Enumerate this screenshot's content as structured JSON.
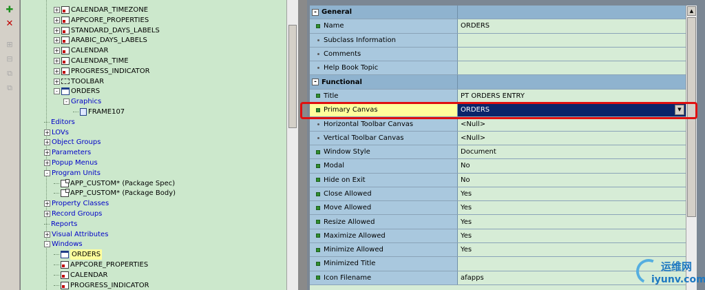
{
  "toolbar": {
    "buttons": [
      {
        "icon": "plus-icon",
        "glyph": "✚"
      },
      {
        "icon": "close-icon",
        "glyph": "✕"
      },
      {
        "icon": "expand-icon",
        "glyph": "⊞"
      },
      {
        "icon": "collapse-icon",
        "glyph": "⊟"
      },
      {
        "icon": "expand-all-icon",
        "glyph": "⧉"
      },
      {
        "icon": "collapse-all-icon",
        "glyph": "⧉"
      }
    ]
  },
  "navigator": {
    "items": [
      {
        "label": "CALENDAR_TIMEZONE",
        "indent": 2,
        "expander": "+",
        "icon": "doc",
        "color": "black"
      },
      {
        "label": "APPCORE_PROPERTIES",
        "indent": 2,
        "expander": "+",
        "icon": "doc",
        "color": "black"
      },
      {
        "label": "STANDARD_DAYS_LABELS",
        "indent": 2,
        "expander": "+",
        "icon": "doc",
        "color": "black"
      },
      {
        "label": "ARABIC_DAYS_LABELS",
        "indent": 2,
        "expander": "+",
        "icon": "doc",
        "color": "black"
      },
      {
        "label": "CALENDAR",
        "indent": 2,
        "expander": "+",
        "icon": "doc",
        "color": "black"
      },
      {
        "label": "CALENDAR_TIME",
        "indent": 2,
        "expander": "+",
        "icon": "doc",
        "color": "black"
      },
      {
        "label": "PROGRESS_INDICATOR",
        "indent": 2,
        "expander": "+",
        "icon": "doc",
        "color": "black"
      },
      {
        "label": "TOOLBAR",
        "indent": 2,
        "expander": "+",
        "icon": "tbar",
        "color": "black"
      },
      {
        "label": "ORDERS",
        "indent": 2,
        "expander": "-",
        "icon": "win",
        "color": "black"
      },
      {
        "label": "Graphics",
        "indent": 3,
        "expander": "-",
        "icon": "none",
        "color": "blue"
      },
      {
        "label": "FRAME107",
        "indent": 4,
        "expander": "",
        "icon": "frame",
        "color": "black"
      },
      {
        "label": "Editors",
        "indent": 1,
        "expander": "",
        "icon": "none",
        "color": "blue"
      },
      {
        "label": "LOVs",
        "indent": 1,
        "expander": "+",
        "icon": "none",
        "color": "blue"
      },
      {
        "label": "Object Groups",
        "indent": 1,
        "expander": "+",
        "icon": "none",
        "color": "blue"
      },
      {
        "label": "Parameters",
        "indent": 1,
        "expander": "+",
        "icon": "none",
        "color": "blue"
      },
      {
        "label": "Popup Menus",
        "indent": 1,
        "expander": "+",
        "icon": "none",
        "color": "blue"
      },
      {
        "label": "Program Units",
        "indent": 1,
        "expander": "-",
        "icon": "none",
        "color": "blue"
      },
      {
        "label": "APP_CUSTOM* (Package Spec)",
        "indent": 2,
        "expander": "",
        "icon": "pkg",
        "color": "black"
      },
      {
        "label": "APP_CUSTOM* (Package Body)",
        "indent": 2,
        "expander": "",
        "icon": "pkg",
        "color": "black"
      },
      {
        "label": "Property Classes",
        "indent": 1,
        "expander": "+",
        "icon": "none",
        "color": "blue"
      },
      {
        "label": "Record Groups",
        "indent": 1,
        "expander": "+",
        "icon": "none",
        "color": "blue"
      },
      {
        "label": "Reports",
        "indent": 1,
        "expander": "",
        "icon": "none",
        "color": "blue"
      },
      {
        "label": "Visual Attributes",
        "indent": 1,
        "expander": "+",
        "icon": "none",
        "color": "blue"
      },
      {
        "label": "Windows",
        "indent": 1,
        "expander": "-",
        "icon": "none",
        "color": "blue"
      },
      {
        "label": "ORDERS",
        "indent": 2,
        "expander": "",
        "icon": "win",
        "color": "black",
        "selected": true
      },
      {
        "label": "APPCORE_PROPERTIES",
        "indent": 2,
        "expander": "",
        "icon": "doc",
        "color": "black"
      },
      {
        "label": "CALENDAR",
        "indent": 2,
        "expander": "",
        "icon": "doc",
        "color": "black"
      },
      {
        "label": "PROGRESS_INDICATOR",
        "indent": 2,
        "expander": "",
        "icon": "doc",
        "color": "black"
      }
    ]
  },
  "properties": {
    "rows": [
      {
        "type": "section",
        "name": "General",
        "toggle": "-"
      },
      {
        "type": "prop",
        "name": "Name",
        "value": "ORDERS",
        "marker": "set"
      },
      {
        "type": "prop",
        "name": "Subclass Information",
        "value": "",
        "marker": "def"
      },
      {
        "type": "prop",
        "name": "Comments",
        "value": "",
        "marker": "def"
      },
      {
        "type": "prop",
        "name": "Help Book Topic",
        "value": "",
        "marker": "def"
      },
      {
        "type": "section",
        "name": "Functional",
        "toggle": "-"
      },
      {
        "type": "prop",
        "name": "Title",
        "value": "PT ORDERS ENTRY",
        "marker": "set"
      },
      {
        "type": "prop",
        "name": "Primary Canvas",
        "value": "ORDERS",
        "marker": "set",
        "highlight": true,
        "dropdown": true
      },
      {
        "type": "prop",
        "name": "Horizontal Toolbar Canvas",
        "value": "<Null>",
        "marker": "def"
      },
      {
        "type": "prop",
        "name": "Vertical Toolbar Canvas",
        "value": "<Null>",
        "marker": "def"
      },
      {
        "type": "prop",
        "name": "Window Style",
        "value": "Document",
        "marker": "set"
      },
      {
        "type": "prop",
        "name": "Modal",
        "value": "No",
        "marker": "set"
      },
      {
        "type": "prop",
        "name": "Hide on Exit",
        "value": "No",
        "marker": "set"
      },
      {
        "type": "prop",
        "name": "Close Allowed",
        "value": "Yes",
        "marker": "set"
      },
      {
        "type": "prop",
        "name": "Move Allowed",
        "value": "Yes",
        "marker": "set"
      },
      {
        "type": "prop",
        "name": "Resize Allowed",
        "value": "Yes",
        "marker": "set"
      },
      {
        "type": "prop",
        "name": "Maximize Allowed",
        "value": "Yes",
        "marker": "set"
      },
      {
        "type": "prop",
        "name": "Minimize Allowed",
        "value": "Yes",
        "marker": "set"
      },
      {
        "type": "prop",
        "name": "Minimized Title",
        "value": "",
        "marker": "set"
      },
      {
        "type": "prop",
        "name": "Icon Filename",
        "value": "afapps",
        "marker": "set"
      }
    ],
    "dropdown_glyph": "▼",
    "scroll_up_glyph": "▲"
  },
  "watermark": {
    "brand_cn": "运维网",
    "url": "iyunv.com"
  }
}
